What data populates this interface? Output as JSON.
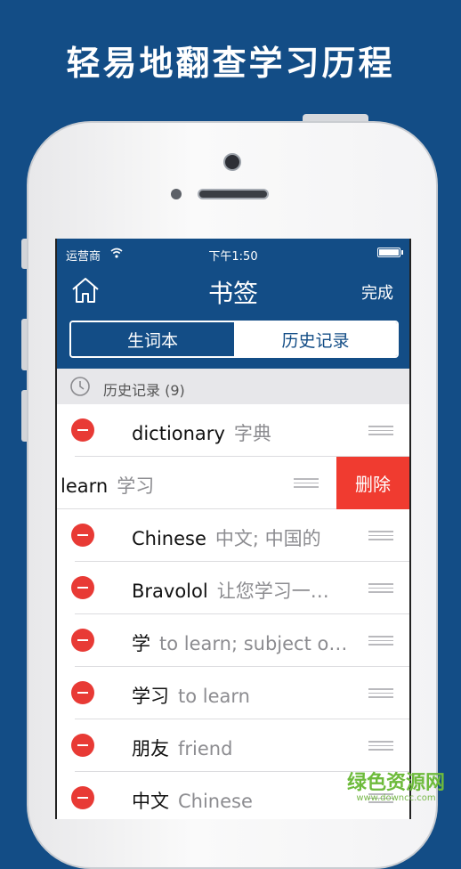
{
  "headline": "轻易地翻查学习历程",
  "status": {
    "carrier": "运营商",
    "time": "下午1:50"
  },
  "nav": {
    "title": "书签",
    "done_label": "完成"
  },
  "segments": [
    {
      "label": "生词本",
      "active": false
    },
    {
      "label": "历史记录",
      "active": true
    }
  ],
  "section": {
    "title": "历史记录 (9)"
  },
  "rows": [
    {
      "word": "dictionary",
      "meaning": "字典"
    },
    {
      "word": "learn",
      "meaning": "学习",
      "delete_label": "删除"
    },
    {
      "word": "Chinese",
      "meaning": "中文; 中国的"
    },
    {
      "word": "Bravolol",
      "meaning": "让您学习一…"
    },
    {
      "word": "学",
      "meaning": "to learn; subject o…"
    },
    {
      "word": "学习",
      "meaning": "to learn"
    },
    {
      "word": "朋友",
      "meaning": "friend"
    },
    {
      "word": "中文",
      "meaning": "Chinese"
    }
  ],
  "watermark": {
    "text": "绿色资源网",
    "subtext": "www.downcc.com"
  },
  "colors": {
    "brand_blue": "#134d86",
    "delete_red": "#f03b30",
    "minus_red": "#e83a35"
  }
}
